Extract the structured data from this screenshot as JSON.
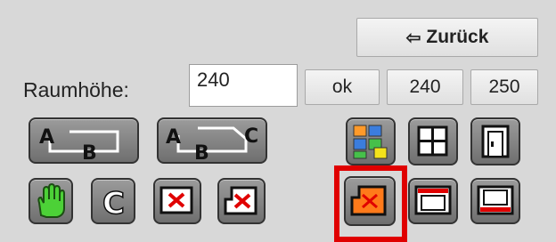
{
  "back_button": {
    "arrow": "⇦",
    "label": "Zurück"
  },
  "room_height": {
    "label": "Raumhöhe:",
    "value": "240",
    "ok_label": "ok",
    "presets": [
      "240",
      "250"
    ]
  },
  "toolbar_row1": [
    {
      "name": "wall-a-b-icon",
      "letters": [
        "A",
        "B"
      ]
    },
    {
      "name": "wall-a-b-c-icon",
      "letters": [
        "A",
        "B",
        "C"
      ]
    },
    {
      "name": "color-tiles-icon"
    },
    {
      "name": "window-icon"
    },
    {
      "name": "door-icon"
    }
  ],
  "toolbar_row2": [
    {
      "name": "hand-icon"
    },
    {
      "name": "c-shape-icon",
      "letters": [
        "C"
      ]
    },
    {
      "name": "delete-rect-icon"
    },
    {
      "name": "delete-room-icon"
    },
    {
      "name": "delete-room-orange-icon",
      "selected": true
    },
    {
      "name": "wall-frame-top-icon"
    },
    {
      "name": "wall-frame-bottom-icon"
    }
  ],
  "colors": {
    "panel": "#d8d8d8",
    "selection": "#e00000",
    "delete_red": "#e00000",
    "hand_green": "#4cd137",
    "orange": "#ff7a1a"
  }
}
